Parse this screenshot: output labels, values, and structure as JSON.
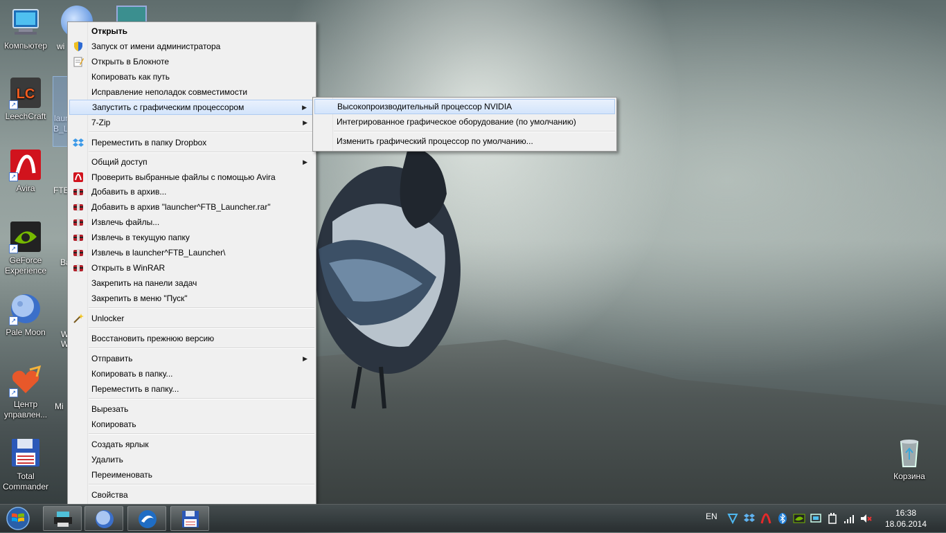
{
  "desktop": {
    "icons": [
      {
        "name": "computer",
        "label": "Компьютер"
      },
      {
        "name": "leechcraft",
        "label": "LeechCraft",
        "glyph": "LC"
      },
      {
        "name": "avira",
        "label": "Avira"
      },
      {
        "name": "geforce",
        "label": "GeForce Experience"
      },
      {
        "name": "palemoon",
        "label": "Pale Moon"
      },
      {
        "name": "center",
        "label": "Центр управлен..."
      },
      {
        "name": "totalcmd",
        "label": "Total Commander"
      },
      {
        "name": "recycle",
        "label": "Корзина"
      }
    ],
    "partial_labels": [
      "wi",
      "laun",
      "B_La",
      "FTB",
      "Ba",
      "W",
      "W",
      "Mi"
    ]
  },
  "context_menu": {
    "items": [
      {
        "label": "Открыть",
        "bold": true
      },
      {
        "label": "Запуск от имени администратора",
        "icon": "shield-icon"
      },
      {
        "label": "Открыть в Блокноте",
        "icon": "notepad-icon"
      },
      {
        "label": "Копировать как путь"
      },
      {
        "label": "Исправление неполадок совместимости"
      },
      {
        "label": "Запустить с графическим процессором",
        "submenu": true,
        "highlighted": true
      },
      {
        "label": "7-Zip",
        "submenu": true
      },
      {
        "label": "Переместить в папку Dropbox",
        "icon": "dropbox-icon"
      },
      {
        "label": "Общий доступ",
        "submenu": true
      },
      {
        "label": "Проверить выбранные файлы с помощью Avira",
        "icon": "avira-icon"
      },
      {
        "label": "Добавить в архив...",
        "icon": "winrar-icon"
      },
      {
        "label": "Добавить в архив \"launcher^FTB_Launcher.rar\"",
        "icon": "winrar-icon"
      },
      {
        "label": "Извлечь файлы...",
        "icon": "winrar-icon"
      },
      {
        "label": "Извлечь в текущую папку",
        "icon": "winrar-icon"
      },
      {
        "label": "Извлечь в launcher^FTB_Launcher\\",
        "icon": "winrar-icon"
      },
      {
        "label": "Открыть в WinRAR",
        "icon": "winrar-icon"
      },
      {
        "label": "Закрепить на панели задач"
      },
      {
        "label": "Закрепить в меню \"Пуск\""
      },
      {
        "label": "Unlocker",
        "icon": "wand-icon"
      },
      {
        "label": "Восстановить прежнюю версию"
      },
      {
        "label": "Отправить",
        "submenu": true
      },
      {
        "label": "Копировать в папку..."
      },
      {
        "label": "Переместить в папку..."
      },
      {
        "label": "Вырезать"
      },
      {
        "label": "Копировать"
      },
      {
        "label": "Создать ярлык"
      },
      {
        "label": "Удалить"
      },
      {
        "label": "Переименовать"
      },
      {
        "label": "Свойства"
      }
    ]
  },
  "gpu_submenu": {
    "items": [
      {
        "label": "Высокопроизводительный процессор NVIDIA",
        "highlighted": true
      },
      {
        "label": "Интегрированное графическое оборудование (по умолчанию)"
      },
      {
        "label": "Изменить графический процессор по умолчанию..."
      }
    ]
  },
  "taskbar": {
    "language": "EN",
    "time": "16:38",
    "date": "18.06.2014",
    "pinned": [
      "printer-app",
      "pale-moon",
      "browser-swirl",
      "total-commander"
    ]
  },
  "colors": {
    "menu_bg": "#f0f0f0",
    "highlight": "#d3e4fb",
    "highlight_border": "#aecbf1",
    "avira_red": "#d1131d",
    "nvidia_green": "#76b900"
  }
}
